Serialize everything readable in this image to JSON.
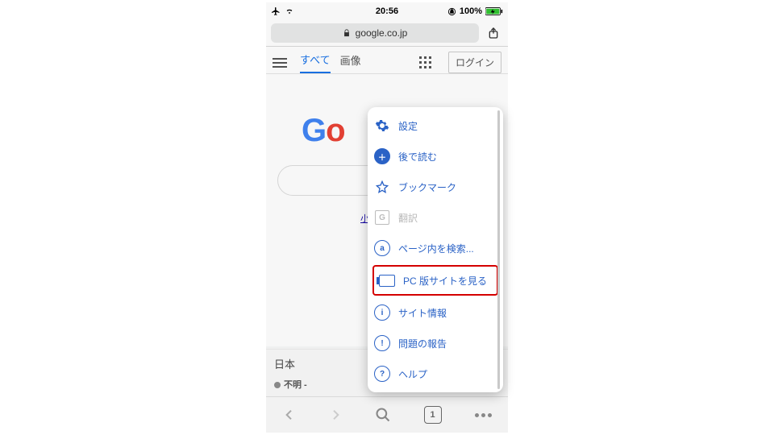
{
  "status": {
    "time": "20:56",
    "battery": "100%"
  },
  "urlbar": {
    "host": "google.co.jp"
  },
  "tabs": {
    "all": "すべて",
    "images": "画像",
    "login": "ログイン"
  },
  "logo": {
    "g1": "G",
    "o1": "o"
  },
  "link": {
    "text": "小さな妖精が"
  },
  "loc": {
    "country": "日本",
    "detail": "不明 -"
  },
  "menu": {
    "settings": "設定",
    "later": "後で読む",
    "bookmark": "ブックマーク",
    "translate": "翻訳",
    "find": "ページ内を検索...",
    "desktop": "PC 版サイトを見る",
    "siteinfo": "サイト情報",
    "report": "問題の報告",
    "help": "ヘルプ"
  },
  "nav": {
    "tabcount": "1"
  }
}
